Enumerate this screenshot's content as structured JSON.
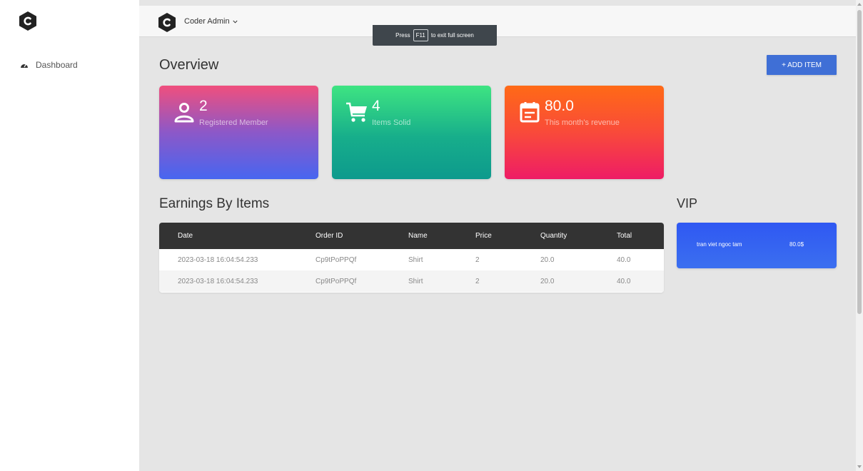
{
  "sidebar": {
    "items": [
      {
        "label": "Dashboard",
        "icon": "tachometer-icon"
      }
    ]
  },
  "topbar": {
    "user_label": "Coder Admin"
  },
  "toast": {
    "prefix": "Press",
    "key": "F11",
    "suffix": "to exit full screen"
  },
  "main": {
    "overview_title": "Overview",
    "add_button": "+ ADD ITEM",
    "cards": [
      {
        "value": "2",
        "label": "Registered Member",
        "icon": "user-icon"
      },
      {
        "value": "4",
        "label": "Items Solid",
        "icon": "cart-icon"
      },
      {
        "value": "80.0",
        "label": "This month's revenue",
        "icon": "calendar-icon"
      }
    ],
    "earnings_title": "Earnings By Items",
    "table": {
      "columns": [
        "Date",
        "Order ID",
        "Name",
        "Price",
        "Quantity",
        "Total"
      ],
      "rows": [
        [
          "2023-03-18 16:04:54.233",
          "Cp9tPoPPQf",
          "Shirt",
          "2",
          "20.0",
          "40.0"
        ],
        [
          "2023-03-18 16:04:54.233",
          "Cp9tPoPPQf",
          "Shirt",
          "2",
          "20.0",
          "40.0"
        ]
      ]
    },
    "vip_title": "VIP",
    "vip": {
      "name": "tran viet ngoc tam",
      "amount": "80.0$"
    }
  },
  "colors": {
    "accent_button": "#3f6fd6",
    "table_header": "#333333",
    "vip_card": "#2f58f2"
  }
}
